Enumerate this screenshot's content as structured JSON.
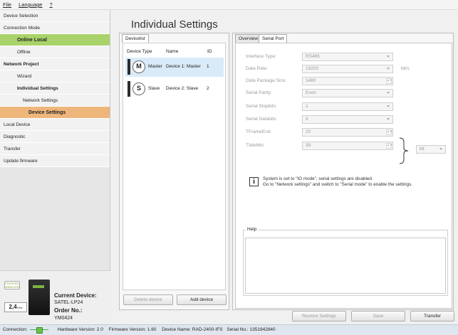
{
  "menubar": {
    "file": "File",
    "language": "Language",
    "help": "?"
  },
  "sidebar": {
    "items": [
      {
        "label": "Device Selection"
      },
      {
        "label": "Connection Mode"
      },
      {
        "label": "Online Local"
      },
      {
        "label": "Offline"
      },
      {
        "label": "Network Project"
      },
      {
        "label": "Wizard"
      },
      {
        "label": "Individual Settings"
      },
      {
        "label": "Network Settings"
      },
      {
        "label": "Device Settings"
      },
      {
        "label": "Local Device"
      },
      {
        "label": "Diagnostic"
      },
      {
        "label": "Transfer"
      },
      {
        "label": "Update firmware"
      }
    ]
  },
  "device_card": {
    "logo_text": "TRUSTED WIRELESS",
    "band": "2,4",
    "band_unit": "GHz",
    "title": "Current Device:",
    "model": "SATEL-LP24",
    "order_label": "Order No.:",
    "order_no": "YM0424"
  },
  "page": {
    "title": "Individual Settings"
  },
  "devicelist": {
    "tab": "Devicelist",
    "columns": {
      "type": "Device Type",
      "name": "Name",
      "id": "ID"
    },
    "rows": [
      {
        "letter": "M",
        "type": "Master",
        "name": "Device 1: Master",
        "id": "1"
      },
      {
        "letter": "S",
        "type": "Slave",
        "name": "Device 2: Slave",
        "id": "2"
      }
    ],
    "delete_label": "Delete device",
    "add_label": "Add device"
  },
  "tabs": {
    "overview": "Overview",
    "serial": "Serial Port"
  },
  "serial": {
    "fields": [
      {
        "label": "Interface Type:",
        "value": "RS485",
        "kind": "select",
        "unit": ""
      },
      {
        "label": "Data Rate:",
        "value": "19200",
        "kind": "select",
        "unit": "bit/s"
      },
      {
        "label": "Data Package Size:",
        "value": "1480",
        "kind": "spin",
        "unit": ""
      },
      {
        "label": "Serial Parity:",
        "value": "Even",
        "kind": "select",
        "unit": ""
      },
      {
        "label": "Serial Stopbits:",
        "value": "1",
        "kind": "select",
        "unit": ""
      },
      {
        "label": "Serial Databits:",
        "value": "8",
        "kind": "select",
        "unit": ""
      },
      {
        "label": "TFrameEnd:",
        "value": "20",
        "kind": "spin",
        "unit": ""
      },
      {
        "label": "TIdleMin:",
        "value": "39",
        "kind": "spin",
        "unit": ""
      }
    ],
    "time_unit": "bit",
    "info_line1": "System is set to \"IO mode\", serial settings are disabled.",
    "info_line2": "Go to \"Network settings\" and switch to \"Serial mode\" to enable the settings.",
    "help_label": "Help"
  },
  "footer_buttons": {
    "restore": "Restore Settings",
    "save": "Save",
    "transfer": "Transfer"
  },
  "status": {
    "connection": "Connection:",
    "hw": "Hardware Version: 2.0",
    "fw": "Firmware Version: 1.60",
    "device_name": "Device Name: RAD-2400-IFS",
    "serial": "Serial No.: 1351942840"
  }
}
